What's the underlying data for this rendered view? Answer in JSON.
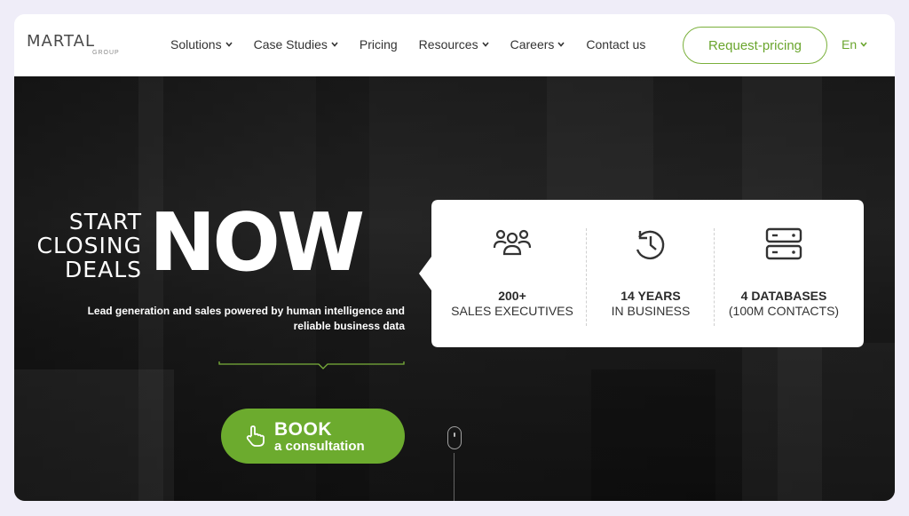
{
  "brand": {
    "name": "MARTAL",
    "sub": "GROUP"
  },
  "nav": {
    "items": [
      {
        "label": "Solutions",
        "has_dropdown": true
      },
      {
        "label": "Case Studies",
        "has_dropdown": true
      },
      {
        "label": "Pricing",
        "has_dropdown": false
      },
      {
        "label": "Resources",
        "has_dropdown": true
      },
      {
        "label": "Careers",
        "has_dropdown": true
      },
      {
        "label": "Contact us",
        "has_dropdown": false
      }
    ],
    "cta_label": "Request-pricing",
    "language": "En"
  },
  "hero": {
    "start_lines": [
      "START",
      "CLOSING",
      "DEALS"
    ],
    "headline": "NOW",
    "tagline_line1": "Lead generation and sales powered by human intelligence and",
    "tagline_line2": "reliable business data",
    "book": {
      "title": "BOOK",
      "subtitle": "a consultation",
      "icon": "hand-pointer-icon"
    }
  },
  "stats": [
    {
      "value": "200+",
      "label": "SALES EXECUTIVES",
      "icon": "team-icon"
    },
    {
      "value": "14 YEARS",
      "label": "IN BUSINESS",
      "icon": "history-clock-icon"
    },
    {
      "value": "4 DATABASES",
      "label": "(100M CONTACTS)",
      "icon": "database-server-icon"
    }
  ],
  "colors": {
    "accent": "#6cab2e",
    "accent_outline": "#7ab03b",
    "page_bg": "#efedf8",
    "hero_dark": "#2a2a2a"
  }
}
